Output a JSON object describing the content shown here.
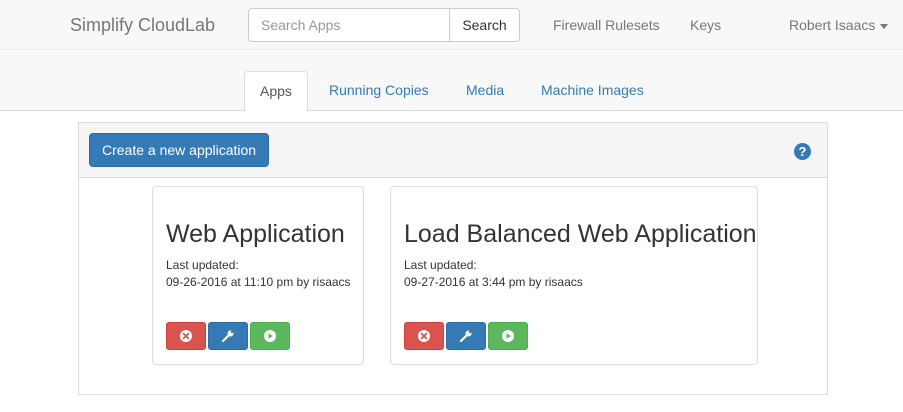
{
  "navbar": {
    "brand": "Simplify CloudLab",
    "search_placeholder": "Search Apps",
    "search_button": "Search",
    "links": [
      "Firewall Rulesets",
      "Keys"
    ],
    "user": "Robert Isaacs"
  },
  "tabs": [
    {
      "label": "Apps",
      "active": true
    },
    {
      "label": "Running Copies",
      "active": false
    },
    {
      "label": "Media",
      "active": false
    },
    {
      "label": "Machine Images",
      "active": false
    }
  ],
  "panel": {
    "create_button": "Create a new application",
    "help_icon": "?"
  },
  "apps": [
    {
      "name": "Web Application",
      "updated_label": "Last updated:",
      "updated_value": "09-26-2016 at 11:10 pm by risaacs"
    },
    {
      "name": "Load Balanced Web Application",
      "updated_label": "Last updated:",
      "updated_value": "09-27-2016 at 3:44 pm by risaacs"
    }
  ],
  "action_icons": [
    "delete-icon",
    "wrench-icon",
    "play-icon"
  ],
  "colors": {
    "primary": "#337ab7",
    "danger": "#d9534f",
    "success": "#5cb85c"
  }
}
